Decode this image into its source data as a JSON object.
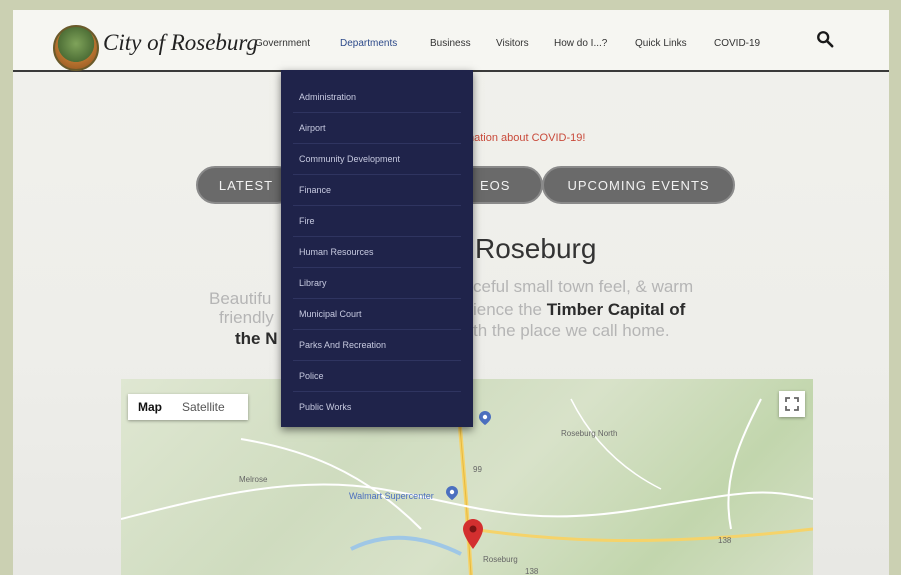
{
  "header": {
    "site_title": "City of Roseburg",
    "nav": [
      "Government",
      "Departments",
      "Business",
      "Visitors",
      "How do I...?",
      "Quick Links",
      "COVID-19"
    ],
    "active_nav": "Departments"
  },
  "dropdown": {
    "items": [
      "Administration",
      "Airport",
      "Community Development",
      "Finance",
      "Fire",
      "Human Resources",
      "Library",
      "Municipal Court",
      "Parks And Recreation",
      "Police",
      "Public Works"
    ]
  },
  "hero": {
    "covid_text": "nation about COVID-19!",
    "buttons": [
      "LATEST",
      "EOS",
      "UPCOMING EVENTS"
    ],
    "welcome": "Roseburg",
    "desc_left_1": "Beautifu",
    "desc_right_1": "ceful small town feel, & warm",
    "desc_left_2": "friendly",
    "desc_right_2a": "ience the ",
    "desc_right_2b": "Timber Capital of",
    "desc_left_3": "the N",
    "desc_right_3": "th the place we call home."
  },
  "map": {
    "btn_map": "Map",
    "btn_satellite": "Satellite",
    "labels": {
      "roseburg_north": "Roseburg North",
      "melrose": "Melrose",
      "walmart": "Walmart Supercenter",
      "roseburg": "Roseburg",
      "route_99": "99",
      "route_138a": "138",
      "route_138b": "138"
    }
  },
  "colors": {
    "dropdown_bg": "#1f234a",
    "nav_active": "#2d4a8a",
    "covid_red": "#c94a3a",
    "pill_bg": "#6a6a6a",
    "pin_red": "#d32f2f"
  },
  "icons": {
    "search": "search-icon",
    "pin": "map-pin-icon",
    "fullscreen": "fullscreen-icon",
    "logo": "city-seal-logo"
  }
}
